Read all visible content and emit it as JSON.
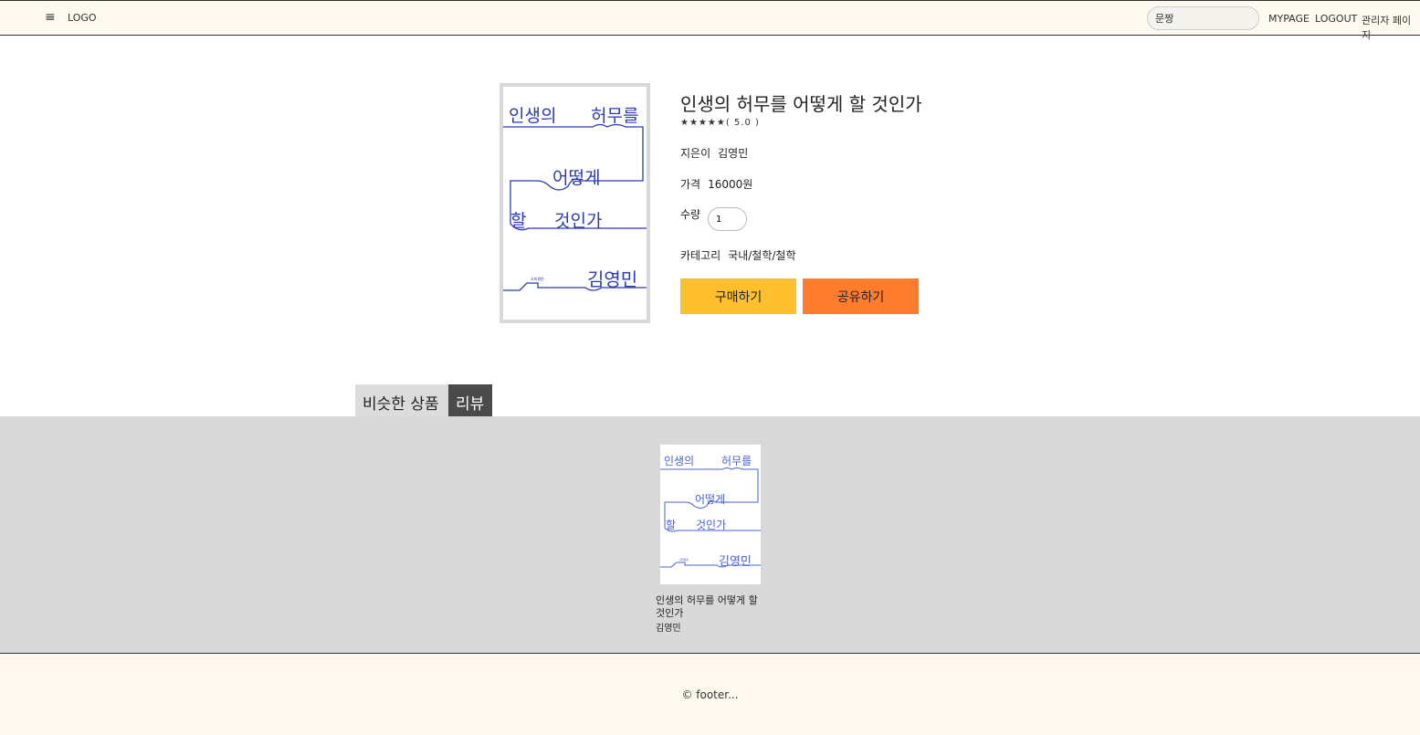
{
  "header": {
    "menu_icon": "hamburger-icon",
    "logo": "LOGO",
    "search_value": "문짱",
    "nav": [
      "MYPAGE",
      "LOGOUT",
      "관리자 페이지"
    ]
  },
  "product": {
    "title": "인생의 허무를 어떻게 할 것인가",
    "stars": "★★★★★",
    "rating_text": "( 5.0 )",
    "author_label": "지은이",
    "author": "김영민",
    "price_label": "가격",
    "price": "16000원",
    "quantity_label": "수량",
    "quantity": "1",
    "category_label": "카테고리",
    "category": "국내/철학/철학",
    "buy_label": "구매하기",
    "share_label": "공유하기"
  },
  "cover_text": {
    "line1a": "인생의",
    "line1b": "허무를",
    "line2": "어떻게",
    "line3a": "할",
    "line3b": "것인가",
    "author": "김영민",
    "publisher": "사회평론"
  },
  "tabs": {
    "similar": "비슷한 상품",
    "review": "리뷰"
  },
  "similar_items": [
    {
      "title": "인생의 허무를 어떻게 할 것인가",
      "author": "김영민"
    }
  ],
  "footer": {
    "text": "© footer..."
  },
  "colors": {
    "header_bg": "#fdf9ef",
    "buy": "#fdbf2d",
    "share": "#fe7d2c",
    "cover_ink": "#2b3bb8",
    "review_tab": "#4a4a4a"
  }
}
